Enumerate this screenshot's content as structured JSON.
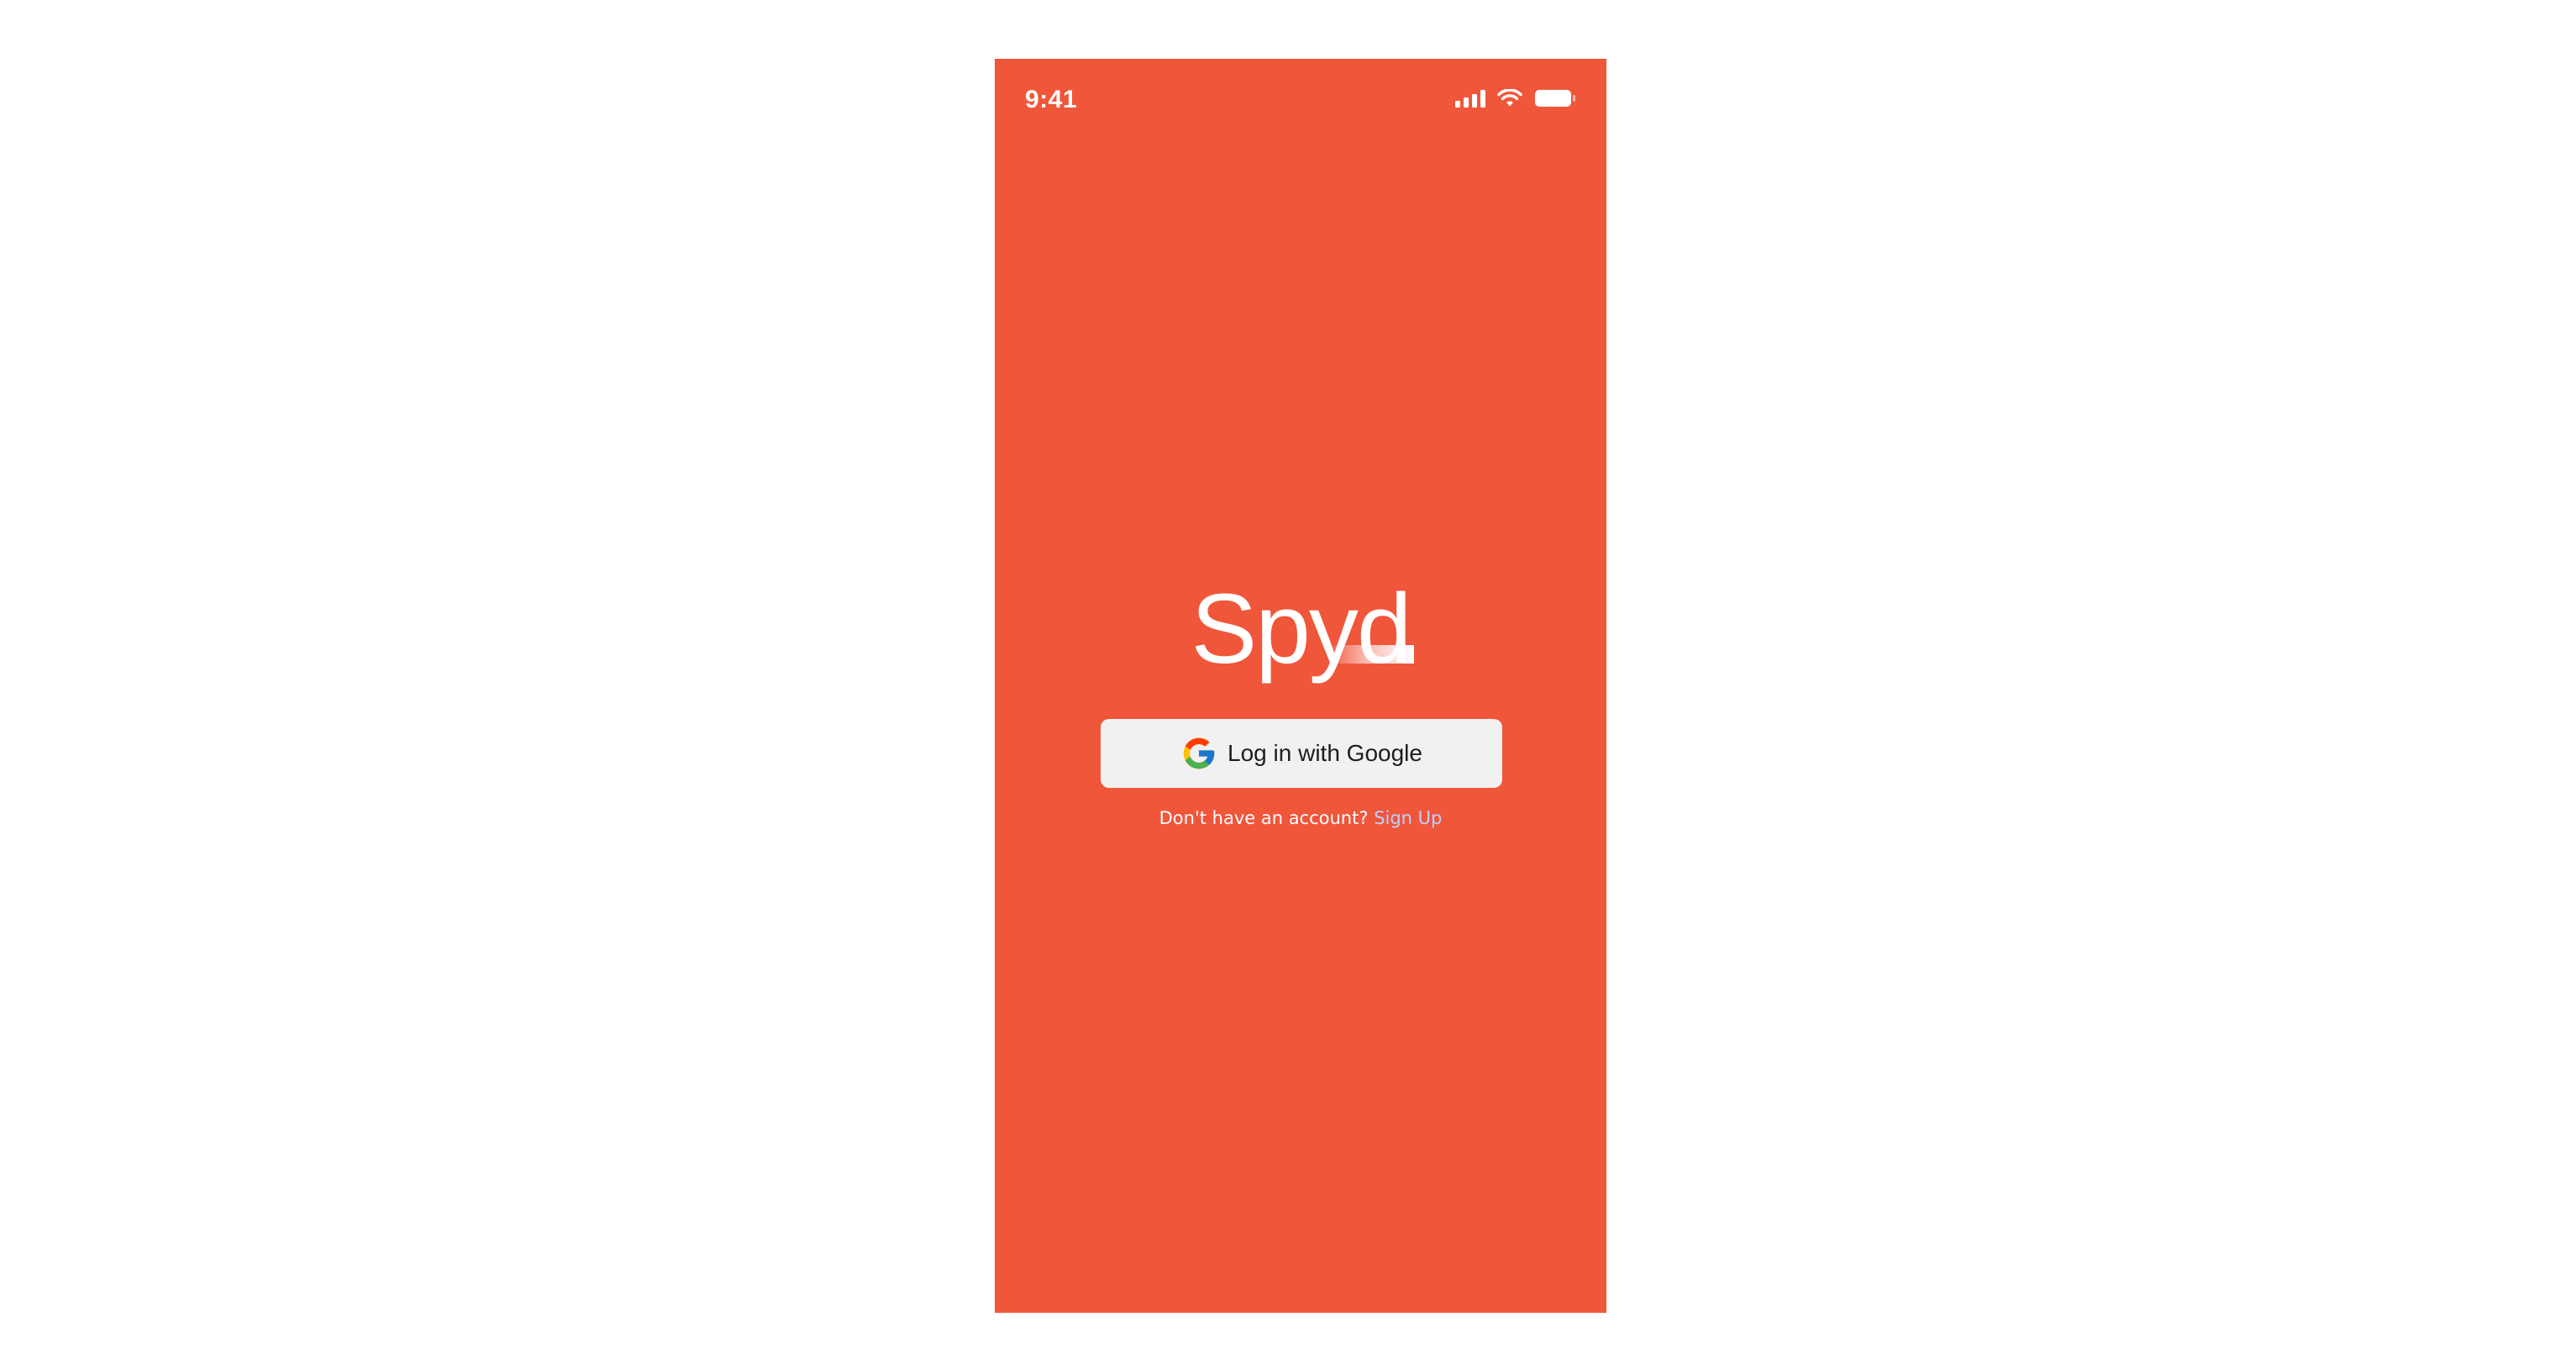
{
  "colors": {
    "background": "#F0563A",
    "page_background": "#FFFFFF",
    "button_background": "#F1F1F1",
    "link": "#B9D3FF"
  },
  "status_bar": {
    "time": "9:41",
    "icons": [
      "cellular-signal-icon",
      "wifi-icon",
      "battery-icon"
    ]
  },
  "logo": {
    "text": "Spyd"
  },
  "login_button": {
    "icon": "google-icon",
    "label": "Log in with Google"
  },
  "signup": {
    "prompt": "Don't have an account?",
    "link_label": "Sign Up"
  }
}
